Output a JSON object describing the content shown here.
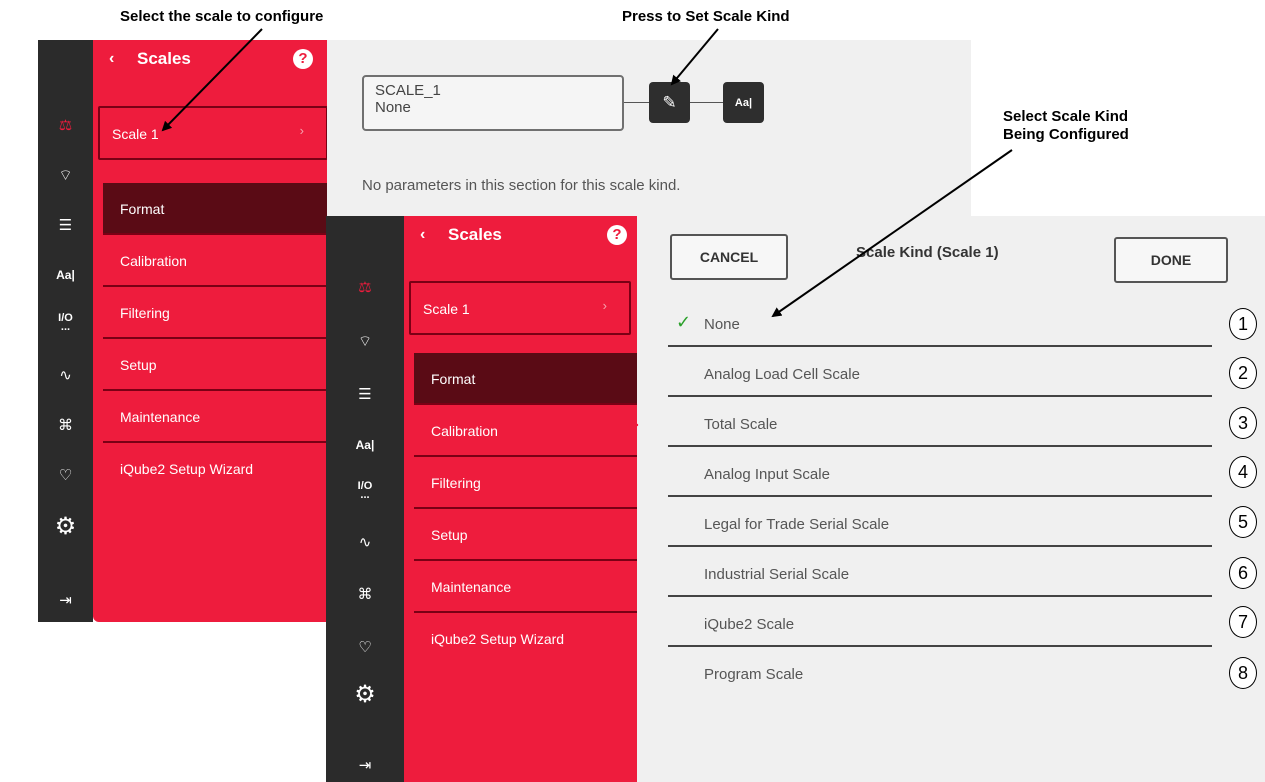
{
  "callouts": {
    "select_scale": "Select the scale to configure",
    "set_kind": "Press to Set Scale Kind",
    "select_kind_line1": "Select Scale Kind",
    "select_kind_line2": "Being Configured"
  },
  "rail_icons": [
    "scale-icon",
    "wireless-icon",
    "list-icon",
    "text-aa-icon",
    "io-icon",
    "signal-icon",
    "network-icon",
    "heart-icon",
    "gear-icon",
    "logout-icon"
  ],
  "panel": {
    "back_glyph": "‹",
    "title": "Scales",
    "help_glyph": "?",
    "scale_selector": "Scale 1",
    "chevron": "›",
    "menu": [
      "Format",
      "Calibration",
      "Filtering",
      "Setup",
      "Maintenance",
      "iQube2 Setup Wizard"
    ]
  },
  "content": {
    "scale_name": "SCALE_1",
    "scale_kind": "None",
    "edit_glyph": "✎",
    "aa_glyph": "Aa|",
    "no_params": "No parameters in this section for this scale kind."
  },
  "dialog": {
    "cancel": "CANCEL",
    "title": "Scale Kind (Scale 1)",
    "done": "DONE",
    "check_glyph": "✓",
    "selected": "None",
    "kinds": [
      "None",
      "Analog Load Cell Scale",
      "Total Scale",
      "Analog Input Scale",
      "Legal for Trade Serial Scale",
      "Industrial Serial Scale",
      "iQube2 Scale",
      "Program Scale"
    ],
    "numbers": [
      "1",
      "2",
      "3",
      "4",
      "5",
      "6",
      "7",
      "8"
    ]
  },
  "colors": {
    "accent_red": "#ee1c3d",
    "menu_selected": "#5a0b15",
    "rail": "#2b2b2b",
    "check_green": "#2aa02a"
  }
}
